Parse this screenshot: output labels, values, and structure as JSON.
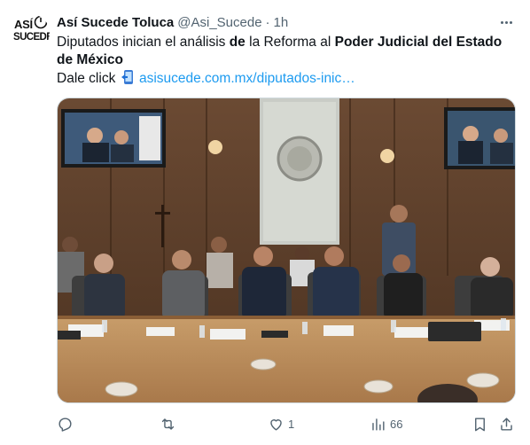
{
  "author": {
    "avatar_text_top": "ASÍ",
    "avatar_text_bottom": "SUCEDE",
    "display_name": "Así Sucede Toluca",
    "handle": "@Asi_Sucede",
    "separator": "·",
    "time": "1h"
  },
  "tweet": {
    "text_1": "Diputados inician el análisis ",
    "text_bold_1": "de",
    "text_2": " la Reforma al ",
    "text_bold_2": "Poder Judicial del Estado de México",
    "text_3": "Dale click",
    "link_text": "asisucede.com.mx/diputados-inic…"
  },
  "actions": {
    "reply_count": "",
    "retweet_count": "",
    "like_count": "1",
    "views_count": "66"
  },
  "colors": {
    "accent": "#1d9bf0",
    "muted": "#536471"
  }
}
